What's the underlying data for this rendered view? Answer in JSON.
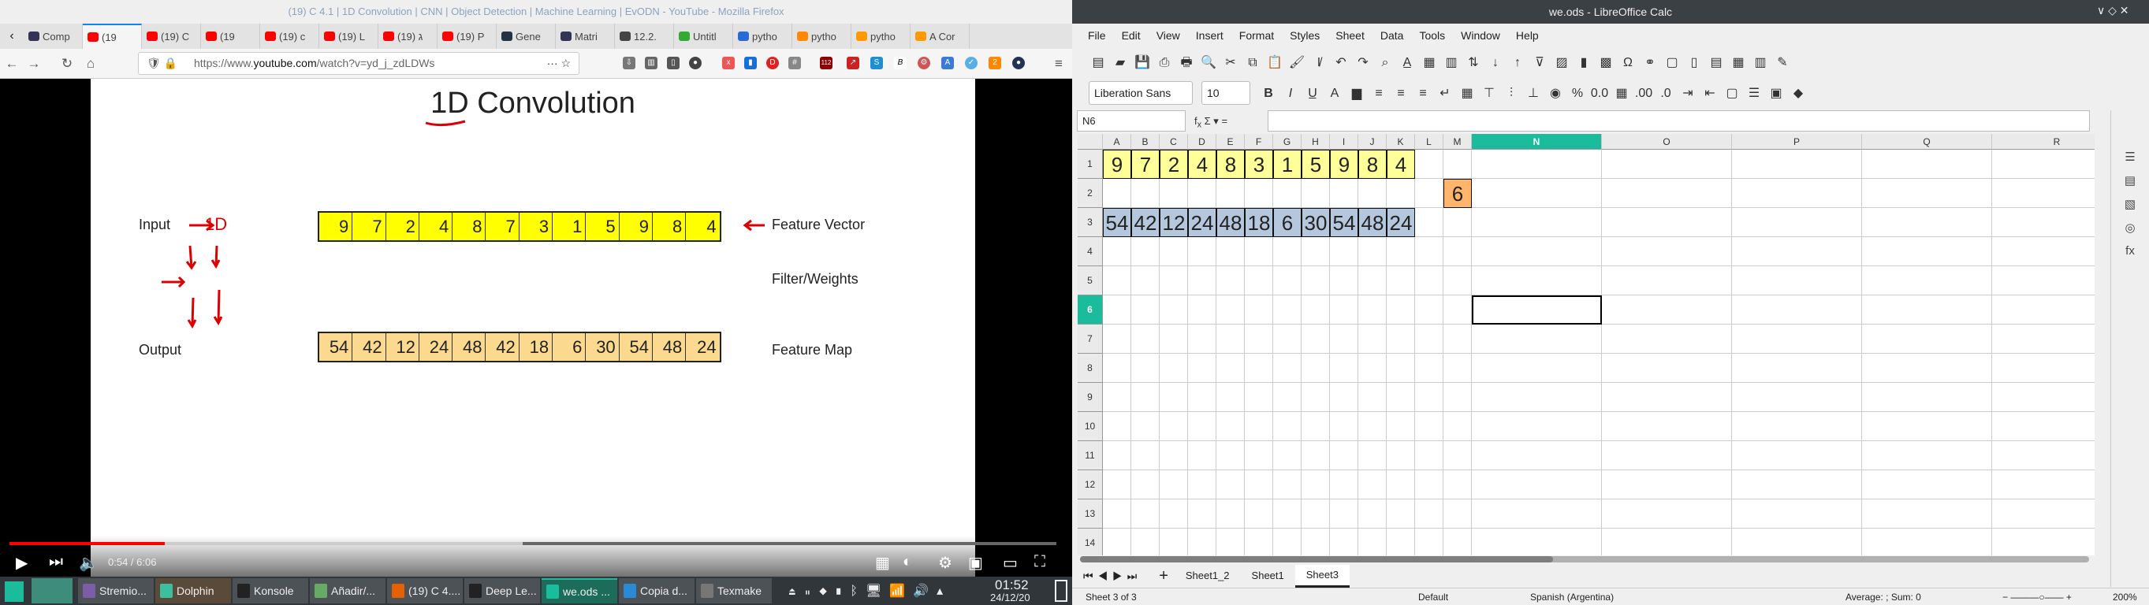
{
  "firefox": {
    "window_title": "(19) C 4.1 | 1D Convolution | CNN | Object Detection | Machine Learning | EvODN - YouTube - Mozilla Firefox",
    "tabs": [
      "Comp",
      "(19",
      "(19) C",
      "(19",
      "(19) c",
      "(19) L",
      "(19) ג",
      "(19) P",
      "Gene",
      "Matri",
      "12.2.",
      "Untitl",
      "pytho",
      "pytho",
      "pytho",
      "A Cor"
    ],
    "active_tab": 1,
    "url_prefix": "https://www.",
    "url_domain": "youtube.com",
    "url_path": "/watch?v=yd_j_zdLDWs",
    "badges": {
      "ublock": "112",
      "ext": "2"
    }
  },
  "slide": {
    "title": "1D Convolution",
    "annotation": "1D",
    "input_label": "Input",
    "output_label": "Output",
    "feature_vector_label": "Feature Vector",
    "filter_label": "Filter/Weights",
    "feature_map_label": "Feature Map",
    "input": [
      9,
      7,
      2,
      4,
      8,
      7,
      3,
      1,
      5,
      9,
      8,
      4
    ],
    "output": [
      54,
      42,
      12,
      24,
      48,
      42,
      18,
      6,
      30,
      54,
      48,
      24
    ],
    "input_color": "#ffff00",
    "output_color": "#fbd98f"
  },
  "player": {
    "time": "0:54 / 6:06",
    "progress": 0.148,
    "buffered": 0.49
  },
  "taskbar": {
    "tasks": [
      "Stremio...",
      "Dolphin",
      "Konsole",
      "Añadir/...",
      "(19) C 4....",
      "Deep Le...",
      "we.ods ...",
      "Copia d...",
      "Texmake"
    ],
    "active": 6,
    "time": "01:52",
    "date": "24/12/20"
  },
  "calc": {
    "window_title": "we.ods - LibreOffice Calc",
    "menu": [
      "File",
      "Edit",
      "View",
      "Insert",
      "Format",
      "Styles",
      "Sheet",
      "Data",
      "Tools",
      "Window",
      "Help"
    ],
    "font_name": "Liberation Sans",
    "font_size": "10",
    "name_box": "N6",
    "formula": "",
    "columns": [
      "A",
      "B",
      "C",
      "D",
      "E",
      "F",
      "G",
      "H",
      "I",
      "J",
      "K",
      "L",
      "M",
      "N",
      "O",
      "P",
      "Q",
      "R"
    ],
    "selected_column": "N",
    "rows": [
      "1",
      "2",
      "3",
      "4",
      "5",
      "6",
      "7",
      "8",
      "9",
      "10",
      "11",
      "12",
      "13",
      "14"
    ],
    "selected_row": "6",
    "row1": [
      9,
      7,
      2,
      4,
      8,
      3,
      1,
      5,
      9,
      8,
      4
    ],
    "m2": 6,
    "row3": [
      54,
      42,
      12,
      24,
      48,
      18,
      6,
      30,
      54,
      48,
      24
    ],
    "colors": {
      "row1": "#ffff99",
      "m2": "#ffb66c",
      "row3": "#b4c7dc",
      "accent": "#1abc9c"
    },
    "sheet_tabs": [
      "Sheet1_2",
      "Sheet1",
      "Sheet3"
    ],
    "active_sheet": "Sheet3",
    "status": {
      "sheet": "Sheet 3 of 3",
      "style": "Default",
      "language": "Spanish (Argentina)",
      "sum": "Average: ; Sum: 0",
      "zoom": "200%"
    }
  }
}
